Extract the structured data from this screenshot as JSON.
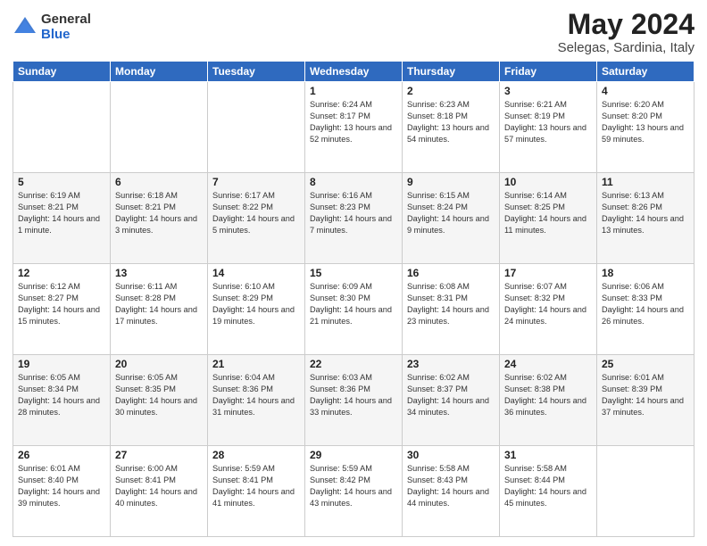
{
  "logo": {
    "general": "General",
    "blue": "Blue"
  },
  "header": {
    "month": "May 2024",
    "location": "Selegas, Sardinia, Italy"
  },
  "weekdays": [
    "Sunday",
    "Monday",
    "Tuesday",
    "Wednesday",
    "Thursday",
    "Friday",
    "Saturday"
  ],
  "weeks": [
    [
      {
        "day": "",
        "info": ""
      },
      {
        "day": "",
        "info": ""
      },
      {
        "day": "",
        "info": ""
      },
      {
        "day": "1",
        "info": "Sunrise: 6:24 AM\nSunset: 8:17 PM\nDaylight: 13 hours\nand 52 minutes."
      },
      {
        "day": "2",
        "info": "Sunrise: 6:23 AM\nSunset: 8:18 PM\nDaylight: 13 hours\nand 54 minutes."
      },
      {
        "day": "3",
        "info": "Sunrise: 6:21 AM\nSunset: 8:19 PM\nDaylight: 13 hours\nand 57 minutes."
      },
      {
        "day": "4",
        "info": "Sunrise: 6:20 AM\nSunset: 8:20 PM\nDaylight: 13 hours\nand 59 minutes."
      }
    ],
    [
      {
        "day": "5",
        "info": "Sunrise: 6:19 AM\nSunset: 8:21 PM\nDaylight: 14 hours\nand 1 minute."
      },
      {
        "day": "6",
        "info": "Sunrise: 6:18 AM\nSunset: 8:21 PM\nDaylight: 14 hours\nand 3 minutes."
      },
      {
        "day": "7",
        "info": "Sunrise: 6:17 AM\nSunset: 8:22 PM\nDaylight: 14 hours\nand 5 minutes."
      },
      {
        "day": "8",
        "info": "Sunrise: 6:16 AM\nSunset: 8:23 PM\nDaylight: 14 hours\nand 7 minutes."
      },
      {
        "day": "9",
        "info": "Sunrise: 6:15 AM\nSunset: 8:24 PM\nDaylight: 14 hours\nand 9 minutes."
      },
      {
        "day": "10",
        "info": "Sunrise: 6:14 AM\nSunset: 8:25 PM\nDaylight: 14 hours\nand 11 minutes."
      },
      {
        "day": "11",
        "info": "Sunrise: 6:13 AM\nSunset: 8:26 PM\nDaylight: 14 hours\nand 13 minutes."
      }
    ],
    [
      {
        "day": "12",
        "info": "Sunrise: 6:12 AM\nSunset: 8:27 PM\nDaylight: 14 hours\nand 15 minutes."
      },
      {
        "day": "13",
        "info": "Sunrise: 6:11 AM\nSunset: 8:28 PM\nDaylight: 14 hours\nand 17 minutes."
      },
      {
        "day": "14",
        "info": "Sunrise: 6:10 AM\nSunset: 8:29 PM\nDaylight: 14 hours\nand 19 minutes."
      },
      {
        "day": "15",
        "info": "Sunrise: 6:09 AM\nSunset: 8:30 PM\nDaylight: 14 hours\nand 21 minutes."
      },
      {
        "day": "16",
        "info": "Sunrise: 6:08 AM\nSunset: 8:31 PM\nDaylight: 14 hours\nand 23 minutes."
      },
      {
        "day": "17",
        "info": "Sunrise: 6:07 AM\nSunset: 8:32 PM\nDaylight: 14 hours\nand 24 minutes."
      },
      {
        "day": "18",
        "info": "Sunrise: 6:06 AM\nSunset: 8:33 PM\nDaylight: 14 hours\nand 26 minutes."
      }
    ],
    [
      {
        "day": "19",
        "info": "Sunrise: 6:05 AM\nSunset: 8:34 PM\nDaylight: 14 hours\nand 28 minutes."
      },
      {
        "day": "20",
        "info": "Sunrise: 6:05 AM\nSunset: 8:35 PM\nDaylight: 14 hours\nand 30 minutes."
      },
      {
        "day": "21",
        "info": "Sunrise: 6:04 AM\nSunset: 8:36 PM\nDaylight: 14 hours\nand 31 minutes."
      },
      {
        "day": "22",
        "info": "Sunrise: 6:03 AM\nSunset: 8:36 PM\nDaylight: 14 hours\nand 33 minutes."
      },
      {
        "day": "23",
        "info": "Sunrise: 6:02 AM\nSunset: 8:37 PM\nDaylight: 14 hours\nand 34 minutes."
      },
      {
        "day": "24",
        "info": "Sunrise: 6:02 AM\nSunset: 8:38 PM\nDaylight: 14 hours\nand 36 minutes."
      },
      {
        "day": "25",
        "info": "Sunrise: 6:01 AM\nSunset: 8:39 PM\nDaylight: 14 hours\nand 37 minutes."
      }
    ],
    [
      {
        "day": "26",
        "info": "Sunrise: 6:01 AM\nSunset: 8:40 PM\nDaylight: 14 hours\nand 39 minutes."
      },
      {
        "day": "27",
        "info": "Sunrise: 6:00 AM\nSunset: 8:41 PM\nDaylight: 14 hours\nand 40 minutes."
      },
      {
        "day": "28",
        "info": "Sunrise: 5:59 AM\nSunset: 8:41 PM\nDaylight: 14 hours\nand 41 minutes."
      },
      {
        "day": "29",
        "info": "Sunrise: 5:59 AM\nSunset: 8:42 PM\nDaylight: 14 hours\nand 43 minutes."
      },
      {
        "day": "30",
        "info": "Sunrise: 5:58 AM\nSunset: 8:43 PM\nDaylight: 14 hours\nand 44 minutes."
      },
      {
        "day": "31",
        "info": "Sunrise: 5:58 AM\nSunset: 8:44 PM\nDaylight: 14 hours\nand 45 minutes."
      },
      {
        "day": "",
        "info": ""
      }
    ]
  ]
}
